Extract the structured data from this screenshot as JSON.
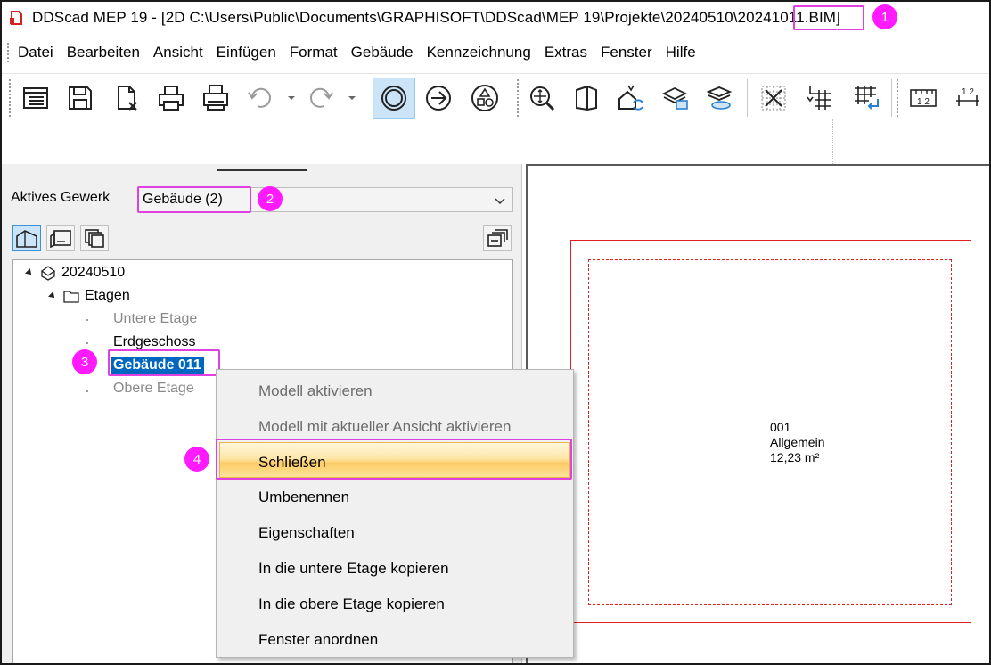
{
  "window": {
    "title": "DDScad MEP 19 - [2D  C:\\Users\\Public\\Documents\\GRAPHISOFT\\DDScad\\MEP 19\\Projekte\\20240510\\20241011.BIM",
    "title_prefix": "DDScad MEP 19 - [2D  C:\\Users\\Public\\Documents\\GRAPHISOFT\\DDScad\\MEP 19\\Projekte\\20240510\\2024",
    "title_highlight": "1011.BIM",
    "title_suffix": "]"
  },
  "menu": [
    "Datei",
    "Bearbeiten",
    "Ansicht",
    "Einfügen",
    "Format",
    "Gebäude",
    "Kennzeichnung",
    "Extras",
    "Fenster",
    "Hilfe"
  ],
  "toolbar": {
    "icons": [
      "properties-icon",
      "save-icon",
      "close-file-icon",
      "print-icon",
      "print-preview-icon",
      "undo-icon",
      "redo-icon",
      "circle-select-icon",
      "arrow-right-icon",
      "shapes-icon",
      "zoom-icon",
      "view-3d-icon",
      "house-sync-icon",
      "layers-icon",
      "layers-stack-icon",
      "grid-cross-icon",
      "grid-arrow-icon",
      "grid-return-icon",
      "ruler-12-icon",
      "dimension-icon"
    ],
    "ruler_text": "1 2",
    "dimension_text": "1.2"
  },
  "left_panel": {
    "gewerk_label": "Aktives Gewerk",
    "gewerk_value": "Gebäude (2)",
    "tree": {
      "root": "20240510",
      "floors_folder": "Etagen",
      "items": [
        {
          "label": "Untere Etage",
          "state": "inactive"
        },
        {
          "label": "Erdgeschoss",
          "state": "normal"
        },
        {
          "label": "Gebäude 011",
          "state": "selected"
        },
        {
          "label": "Obere Etage",
          "state": "inactive"
        }
      ]
    }
  },
  "canvas": {
    "room_number": "001",
    "room_name": "Allgemein",
    "room_area": "12,23 m²",
    "outline_color": "#e02020"
  },
  "context_menu": {
    "items": [
      {
        "label": "Modell aktivieren",
        "enabled": false
      },
      {
        "label": "Modell mit aktueller Ansicht aktivieren",
        "enabled": false
      },
      {
        "label": "Schließen",
        "enabled": true,
        "hovered": true
      },
      {
        "label": "Umbenennen",
        "enabled": true
      },
      {
        "label": "Eigenschaften",
        "enabled": true
      },
      {
        "label": "In die untere Etage kopieren",
        "enabled": true
      },
      {
        "label": "In die obere Etage kopieren",
        "enabled": true
      },
      {
        "label": "Fenster anordnen",
        "enabled": true
      }
    ]
  },
  "annotations": {
    "color": "#ff1aff",
    "badges": [
      "1",
      "2",
      "3",
      "4"
    ]
  }
}
